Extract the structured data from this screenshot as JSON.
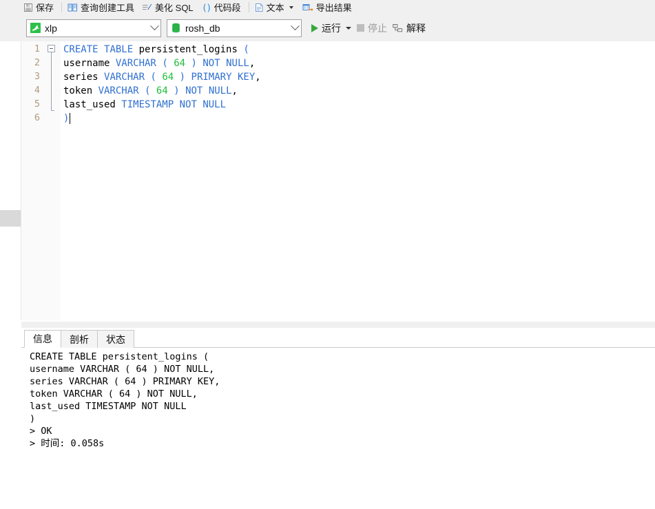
{
  "toolbar_top": {
    "items": [
      {
        "label": "保存",
        "icon": "save-disk-icon",
        "sep_after": true
      },
      {
        "label": "查询创建工具",
        "icon": "query-builder-icon",
        "sep_after": false
      },
      {
        "label": "美化 SQL",
        "icon": "beautify-sql-icon",
        "sep_after": false
      },
      {
        "label": "代码段",
        "icon": "code-snippet-icon",
        "sep_after": true
      },
      {
        "label": "文本",
        "icon": "text-document-icon",
        "caret": true,
        "sep_after": false
      },
      {
        "label": "导出结果",
        "icon": "export-result-icon",
        "sep_after": false
      }
    ]
  },
  "toolbar_second": {
    "connection": {
      "value": "xlp",
      "icon": "mysql-dolphin-icon",
      "arrow": "chevron-down-icon"
    },
    "database": {
      "value": "rosh_db",
      "icon": "database-cylinder-icon",
      "arrow": "chevron-down-icon"
    },
    "run_label": "运行",
    "run_icon": "play-triangle-icon",
    "run_caret": "caret-down-icon",
    "stop_label": "停止",
    "stop_icon": "stop-square-icon",
    "explain_label": "解释",
    "explain_icon": "explain-plan-icon"
  },
  "editor": {
    "gutter_numbers": [
      "1",
      "2",
      "3",
      "4",
      "5",
      "6"
    ],
    "lines": [
      [
        {
          "t": "CREATE",
          "c": "kw"
        },
        {
          "t": " ",
          "c": ""
        },
        {
          "t": "TABLE",
          "c": "kw"
        },
        {
          "t": " persistent_logins ",
          "c": ""
        },
        {
          "t": "(",
          "c": "pun"
        }
      ],
      [
        {
          "t": "username ",
          "c": ""
        },
        {
          "t": "VARCHAR",
          "c": "kw"
        },
        {
          "t": " ",
          "c": ""
        },
        {
          "t": "(",
          "c": "pun"
        },
        {
          "t": " ",
          "c": ""
        },
        {
          "t": "64",
          "c": "num"
        },
        {
          "t": " ",
          "c": ""
        },
        {
          "t": ")",
          "c": "pun"
        },
        {
          "t": " ",
          "c": ""
        },
        {
          "t": "NOT",
          "c": "kw"
        },
        {
          "t": " ",
          "c": ""
        },
        {
          "t": "NULL",
          "c": "kw"
        },
        {
          "t": ",",
          "c": ""
        }
      ],
      [
        {
          "t": "series ",
          "c": ""
        },
        {
          "t": "VARCHAR",
          "c": "kw"
        },
        {
          "t": " ",
          "c": ""
        },
        {
          "t": "(",
          "c": "pun"
        },
        {
          "t": " ",
          "c": ""
        },
        {
          "t": "64",
          "c": "num"
        },
        {
          "t": " ",
          "c": ""
        },
        {
          "t": ")",
          "c": "pun"
        },
        {
          "t": " ",
          "c": ""
        },
        {
          "t": "PRIMARY",
          "c": "kw"
        },
        {
          "t": " ",
          "c": ""
        },
        {
          "t": "KEY",
          "c": "kw"
        },
        {
          "t": ",",
          "c": ""
        }
      ],
      [
        {
          "t": "token ",
          "c": ""
        },
        {
          "t": "VARCHAR",
          "c": "kw"
        },
        {
          "t": " ",
          "c": ""
        },
        {
          "t": "(",
          "c": "pun"
        },
        {
          "t": " ",
          "c": ""
        },
        {
          "t": "64",
          "c": "num"
        },
        {
          "t": " ",
          "c": ""
        },
        {
          "t": ")",
          "c": "pun"
        },
        {
          "t": " ",
          "c": ""
        },
        {
          "t": "NOT",
          "c": "kw"
        },
        {
          "t": " ",
          "c": ""
        },
        {
          "t": "NULL",
          "c": "kw"
        },
        {
          "t": ",",
          "c": ""
        }
      ],
      [
        {
          "t": "last_used ",
          "c": ""
        },
        {
          "t": "TIMESTAMP",
          "c": "kw"
        },
        {
          "t": " ",
          "c": ""
        },
        {
          "t": "NOT",
          "c": "kw"
        },
        {
          "t": " ",
          "c": ""
        },
        {
          "t": "NULL",
          "c": "kw"
        }
      ],
      [
        {
          "t": ")",
          "c": "pun"
        }
      ]
    ]
  },
  "results": {
    "tabs": [
      {
        "label": "信息",
        "active": true
      },
      {
        "label": "剖析",
        "active": false
      },
      {
        "label": "状态",
        "active": false
      }
    ],
    "log_lines": [
      "CREATE TABLE persistent_logins (",
      "username VARCHAR ( 64 ) NOT NULL,",
      "series VARCHAR ( 64 ) PRIMARY KEY,",
      "token VARCHAR ( 64 ) NOT NULL,",
      "last_used TIMESTAMP NOT NULL",
      ")",
      "> OK",
      "> 时间: 0.058s"
    ]
  },
  "colors": {
    "toolbar_bg": "#f0f0f0",
    "keyword": "#2f6fd0",
    "number": "#1fbf3a",
    "gutter_number": "#b09a7e",
    "run_green": "#38a83d",
    "db_green": "#22b14c"
  }
}
